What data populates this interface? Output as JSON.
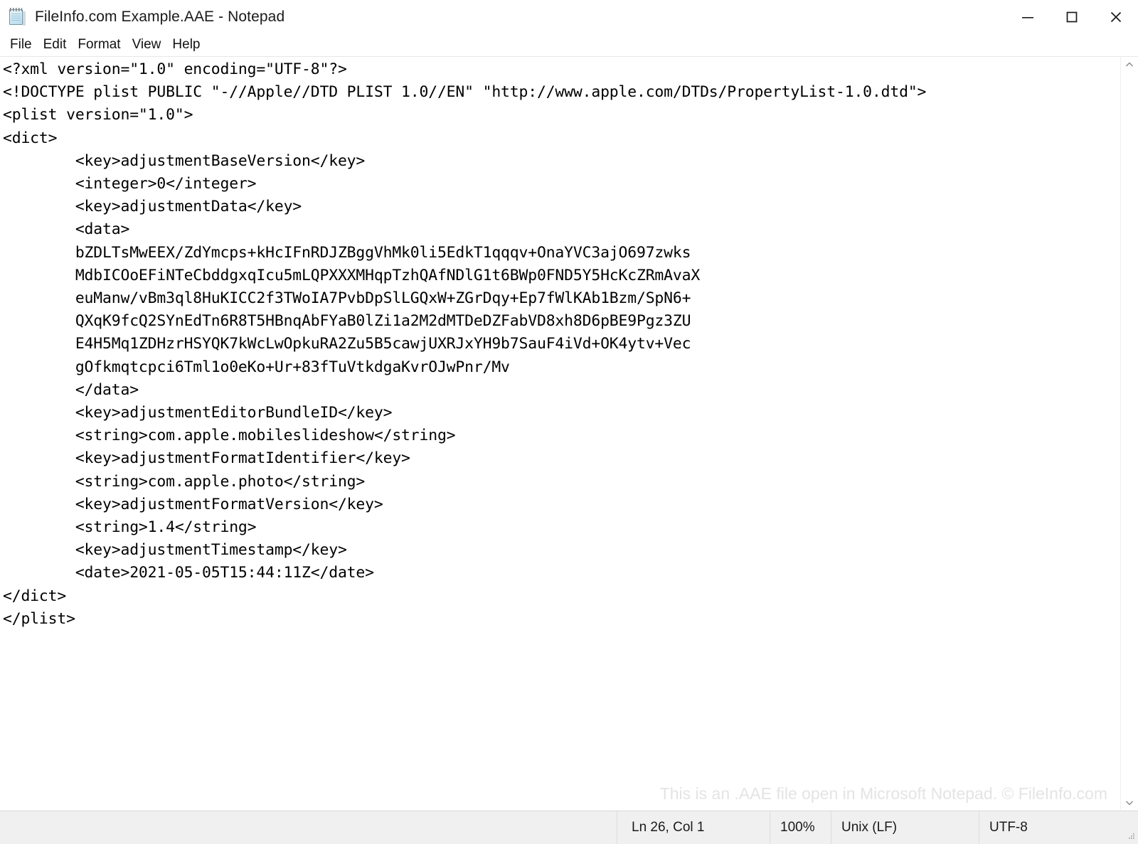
{
  "window": {
    "title": "FileInfo.com Example.AAE - Notepad",
    "app_icon": "notepad-icon",
    "controls": {
      "minimize": "minimize-icon",
      "maximize": "maximize-icon",
      "close": "close-icon"
    }
  },
  "menubar": {
    "items": [
      {
        "label": "File"
      },
      {
        "label": "Edit"
      },
      {
        "label": "Format"
      },
      {
        "label": "View"
      },
      {
        "label": "Help"
      }
    ]
  },
  "editor": {
    "content": "<?xml version=\"1.0\" encoding=\"UTF-8\"?>\n<!DOCTYPE plist PUBLIC \"-//Apple//DTD PLIST 1.0//EN\" \"http://www.apple.com/DTDs/PropertyList-1.0.dtd\">\n<plist version=\"1.0\">\n<dict>\n\t<key>adjustmentBaseVersion</key>\n\t<integer>0</integer>\n\t<key>adjustmentData</key>\n\t<data>\n\tbZDLTsMwEEX/ZdYmcps+kHcIFnRDJZBggVhMk0li5EdkT1qqqv+OnaYVC3ajO697zwks\n\tMdbICOoEFiNTeCbddgxqIcu5mLQPXXXMHqpTzhQAfNDlG1t6BWp0FND5Y5HcKcZRmAvaX\n\teuManw/vBm3ql8HuKICC2f3TWoIA7PvbDpSlLGQxW+ZGrDqy+Ep7fWlKAb1Bzm/SpN6+\n\tQXqK9fcQ2SYnEdTn6R8T5HBnqAbFYaB0lZi1a2M2dMTDeDZFabVD8xh8D6pBE9Pgz3ZU\n\tE4H5Mq1ZDHzrHSYQK7kWcLwOpkuRA2Zu5B5cawjUXRJxYH9b7SauF4iVd+OK4ytv+Vec\n\tgOfkmqtcpci6Tml1o0eKo+Ur+83fTuVtkdgaKvrOJwPnr/Mv\n\t</data>\n\t<key>adjustmentEditorBundleID</key>\n\t<string>com.apple.mobileslideshow</string>\n\t<key>adjustmentFormatIdentifier</key>\n\t<string>com.apple.photo</string>\n\t<key>adjustmentFormatVersion</key>\n\t<string>1.4</string>\n\t<key>adjustmentTimestamp</key>\n\t<date>2021-05-05T15:44:11Z</date>\n</dict>\n</plist>"
  },
  "watermark": {
    "text": "This is an .AAE file open in Microsoft Notepad. © FileInfo.com"
  },
  "scrollbar": {
    "up_arrow": "chevron-up-icon",
    "down_arrow": "chevron-down-icon"
  },
  "statusbar": {
    "cursor_position": "Ln 26, Col 1",
    "zoom_level": "100%",
    "line_ending": "Unix (LF)",
    "encoding": "UTF-8"
  },
  "colors": {
    "titlebar_bg": "#ffffff",
    "editor_bg": "#ffffff",
    "text": "#000000",
    "statusbar_bg": "#f0f0f0",
    "watermark": "#e4e4e4",
    "close_hover": "#e81123"
  }
}
